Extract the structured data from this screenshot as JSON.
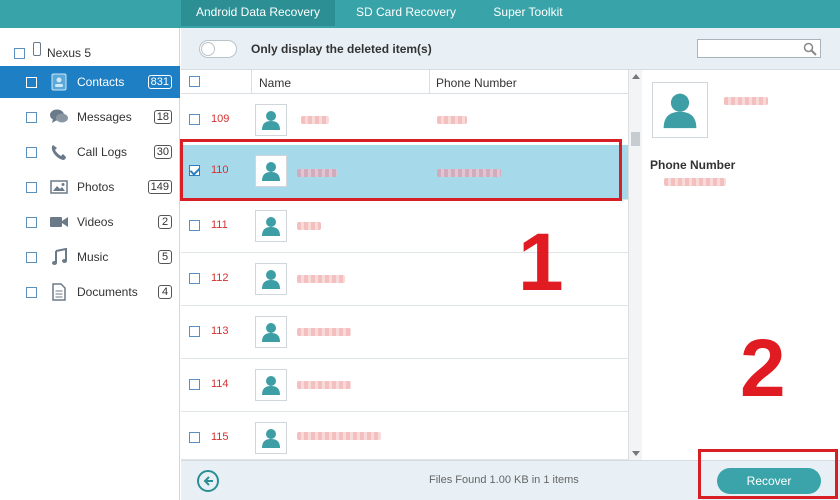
{
  "tabs": [
    {
      "label": "Android Data Recovery",
      "active": true
    },
    {
      "label": "SD Card Recovery",
      "active": false
    },
    {
      "label": "Super Toolkit",
      "active": false
    }
  ],
  "sidebar": {
    "device": "Nexus 5",
    "items": [
      {
        "label": "Contacts",
        "count": "831",
        "icon": "contacts-icon",
        "active": true
      },
      {
        "label": "Messages",
        "count": "18",
        "icon": "messages-icon",
        "active": false
      },
      {
        "label": "Call Logs",
        "count": "30",
        "icon": "phone-icon",
        "active": false
      },
      {
        "label": "Photos",
        "count": "149",
        "icon": "photos-icon",
        "active": false
      },
      {
        "label": "Videos",
        "count": "2",
        "icon": "video-icon",
        "active": false
      },
      {
        "label": "Music",
        "count": "5",
        "icon": "music-icon",
        "active": false
      },
      {
        "label": "Documents",
        "count": "4",
        "icon": "document-icon",
        "active": false
      }
    ]
  },
  "toolbar": {
    "toggle_label": "Only display the deleted item(s)",
    "search_placeholder": ""
  },
  "list": {
    "headers": {
      "name": "Name",
      "phone": "Phone Number"
    },
    "rows": [
      {
        "id": "109",
        "selected": false
      },
      {
        "id": "110",
        "selected": true
      },
      {
        "id": "111",
        "selected": false
      },
      {
        "id": "112",
        "selected": false
      },
      {
        "id": "113",
        "selected": false
      },
      {
        "id": "114",
        "selected": false
      },
      {
        "id": "115",
        "selected": false
      }
    ]
  },
  "detail": {
    "phone_label": "Phone Number"
  },
  "status": {
    "files_found": "Files Found 1.00 KB in 1 items",
    "recover_label": "Recover"
  },
  "annotations": {
    "step1": "1",
    "step2": "2"
  },
  "colors": {
    "brand": "#38a3a8",
    "active_sidebar": "#1f7fc4",
    "selected_row": "#a6d9ea",
    "annotation_red": "#d91f26"
  }
}
